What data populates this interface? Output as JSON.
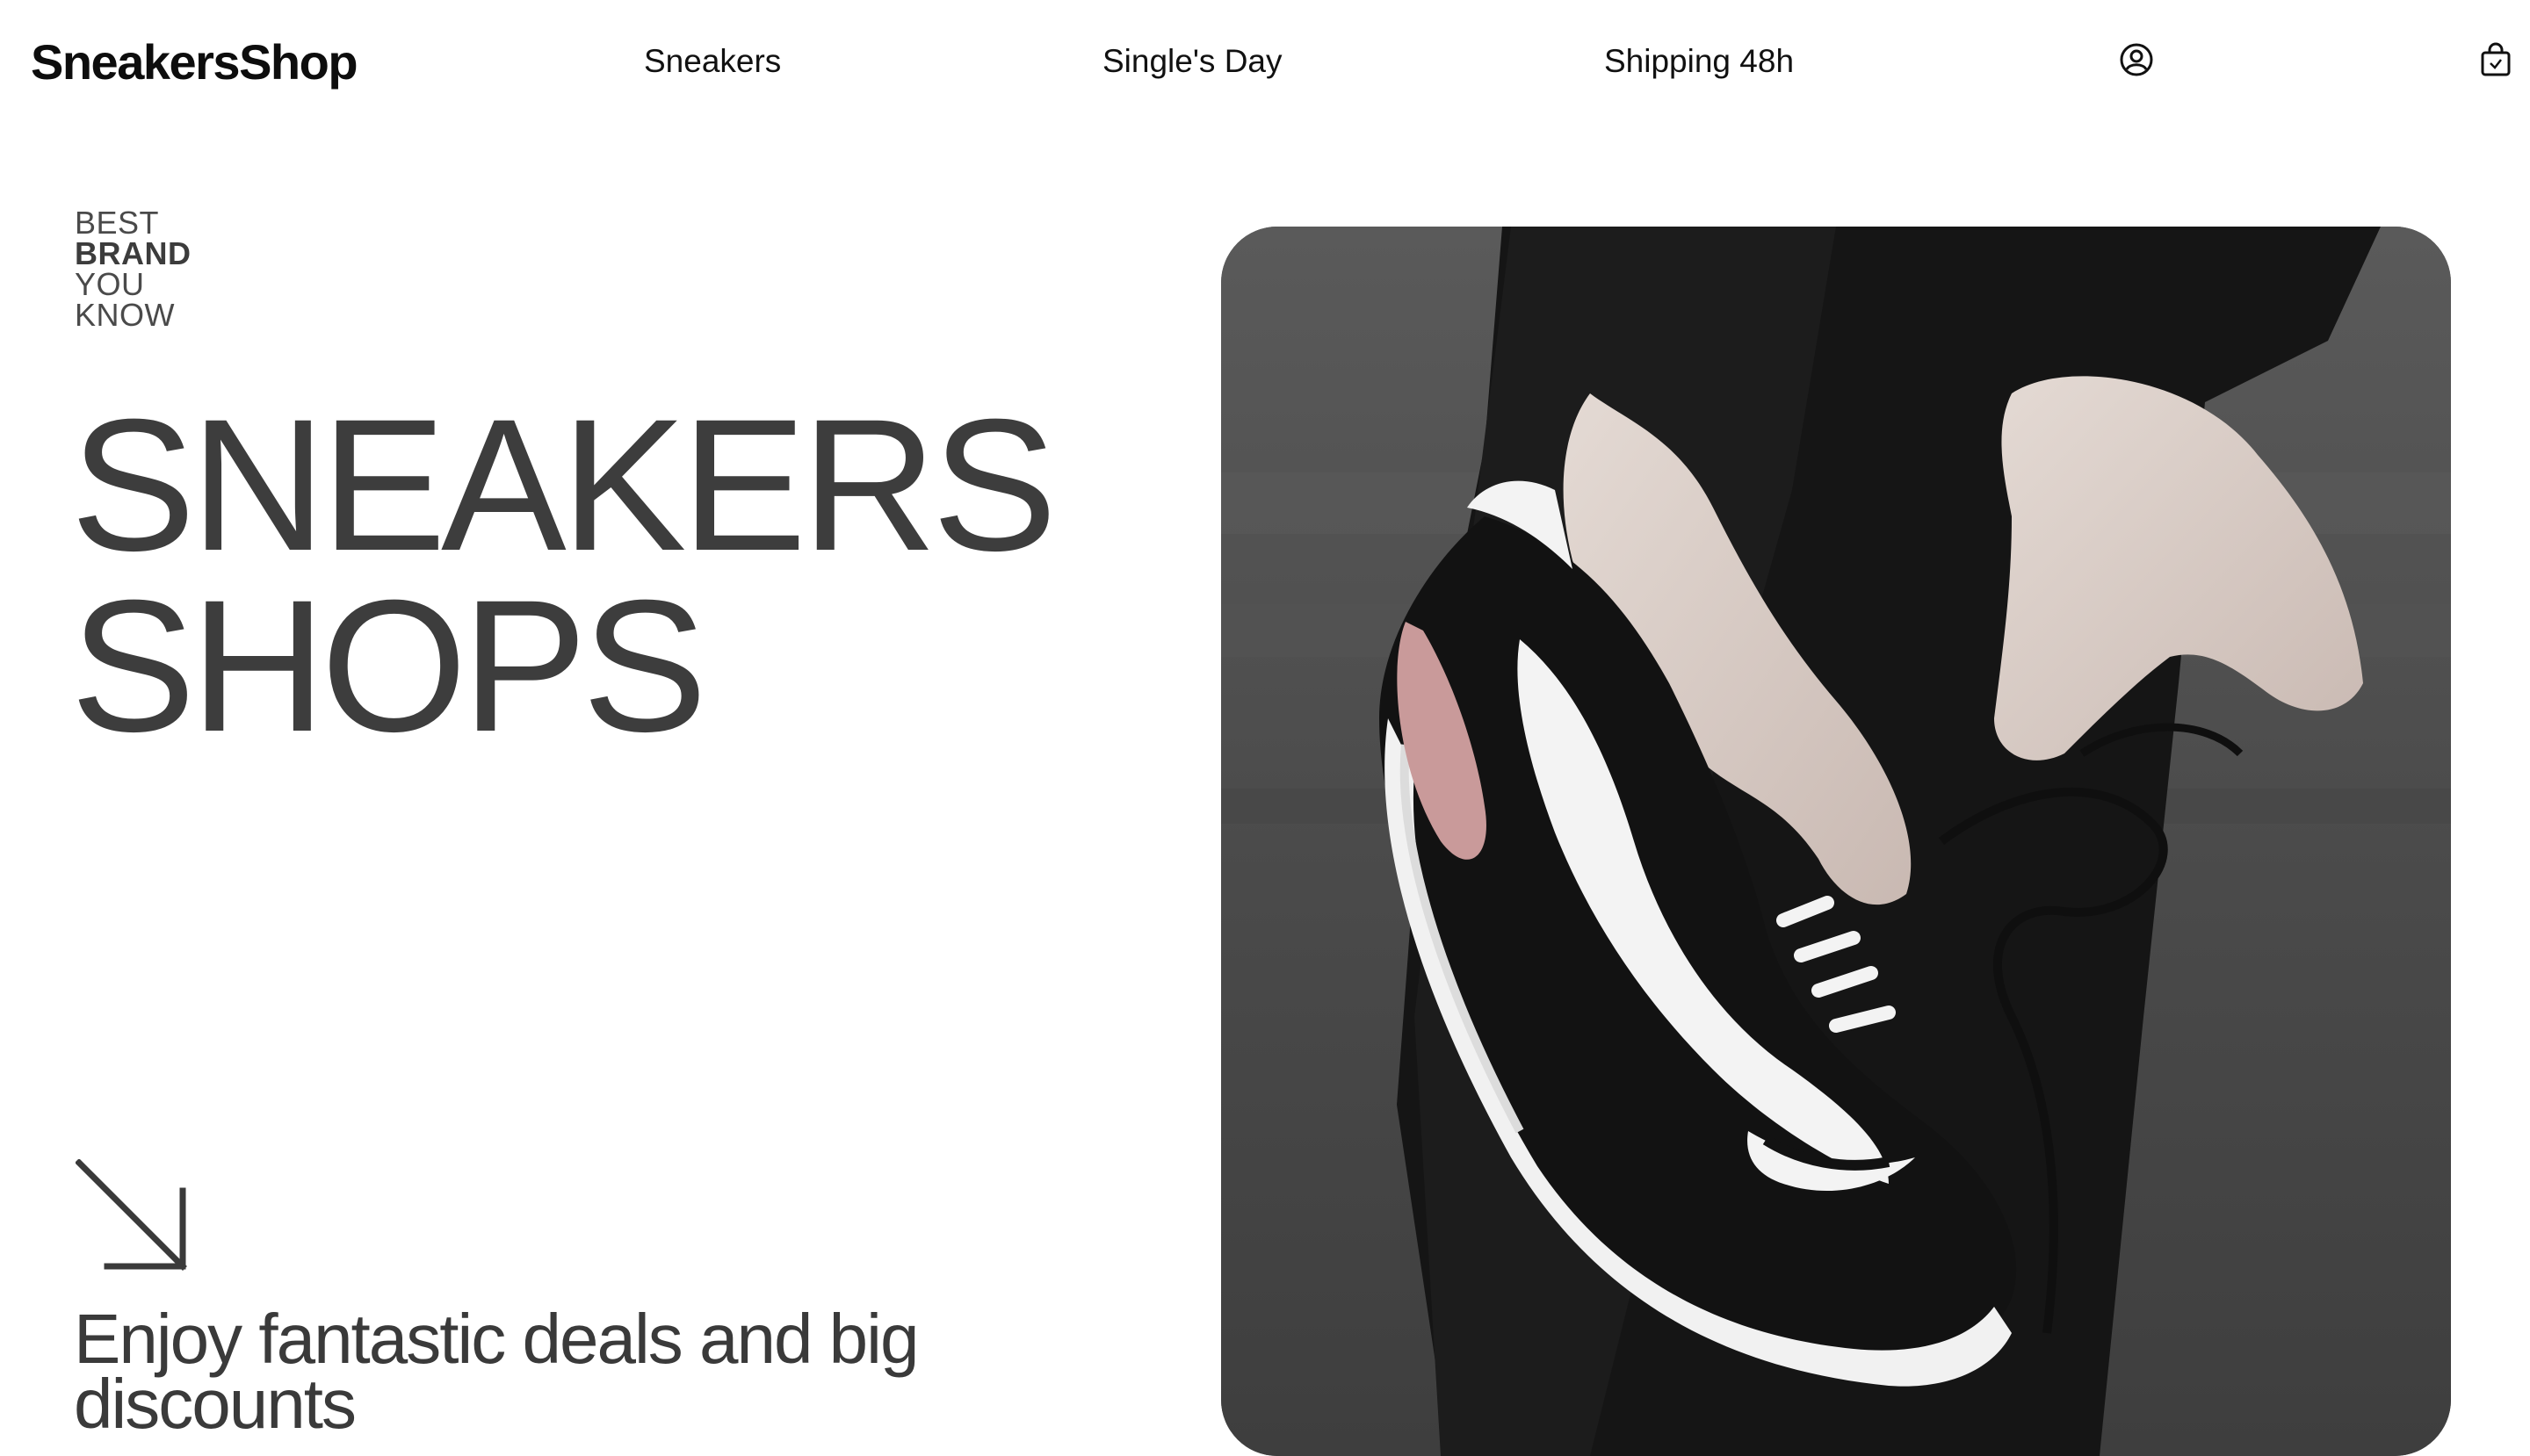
{
  "header": {
    "brand": "SneakersShop",
    "nav": [
      {
        "label": "Sneakers"
      },
      {
        "label": "Single's Day"
      },
      {
        "label": "Shipping 48h"
      }
    ],
    "icons": {
      "account": "account-icon",
      "cart": "shopping-bag-icon"
    }
  },
  "hero": {
    "tagline": {
      "line1": "BEST",
      "line2": "BRAND",
      "line3": "YOU",
      "line4": "KNOW"
    },
    "headline": {
      "line1": "SNEAKERS",
      "line2": "SHOPS"
    },
    "arrow_icon": "arrow-down-right-icon",
    "promo": "Enjoy fantastic deals and big discounts",
    "image": {
      "subject": "hands lacing black and white sneaker",
      "palette": {
        "background": "#4a4a4a",
        "shoe_black": "#111111",
        "shoe_white": "#f2f2f2",
        "skin": "#d9cfc9",
        "air_unit": "#c99a9a"
      }
    }
  },
  "colors": {
    "text_primary": "#111111",
    "headline": "#3d3d3d",
    "tagline": "#4a4a4a"
  }
}
